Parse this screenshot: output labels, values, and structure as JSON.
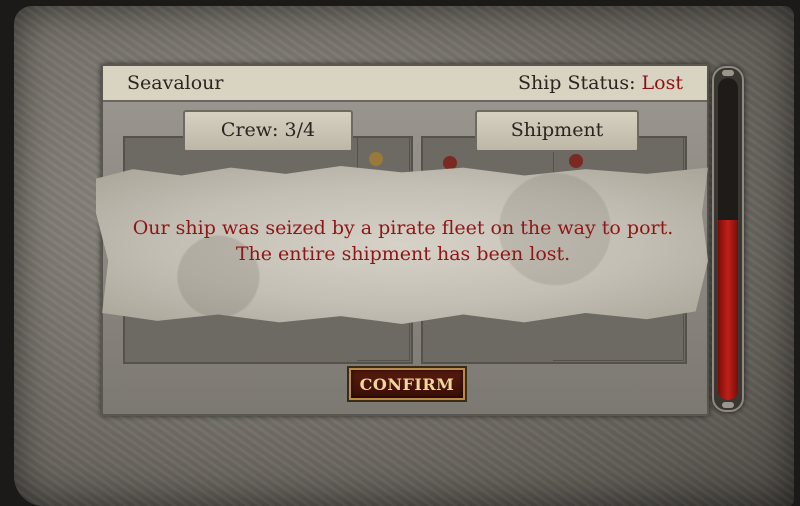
{
  "header": {
    "ship_name": "Seavalour",
    "status_label": "Ship Status:",
    "status_value": "Lost"
  },
  "tabs": {
    "crew_label": "Crew: 3/4",
    "shipment_label": "Shipment"
  },
  "notice": {
    "message": "Our ship was seized by a pirate fleet on the way to port. The entire shipment has been lost."
  },
  "actions": {
    "confirm_label": "CONFIRM"
  },
  "status_bar": {
    "fill_fraction": 0.56,
    "color": "#c02018"
  }
}
